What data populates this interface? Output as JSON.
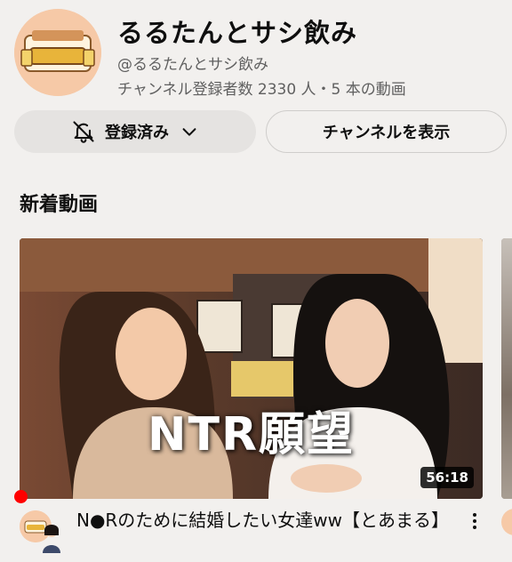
{
  "channel": {
    "name": "るるたんとサシ飲み",
    "handle": "@るるたんとサシ飲み",
    "meta": "チャンネル登録者数 2330 人・5 本の動画"
  },
  "actions": {
    "subscribed_label": "登録済み",
    "view_channel_label": "チャンネルを表示"
  },
  "section": {
    "title": "新着動画"
  },
  "video": {
    "overlay_text": "NTR願望",
    "duration": "56:18",
    "title": "N●Rのために結婚したい女達ww【とあまる】"
  },
  "colors": {
    "background": "#f2f0ee",
    "accent_red": "#ff0000",
    "avatar_bg": "#f6c9a7"
  },
  "icons": {
    "bell": "bell-off-icon",
    "chevron": "chevron-down-icon",
    "more": "more-vert-icon"
  }
}
